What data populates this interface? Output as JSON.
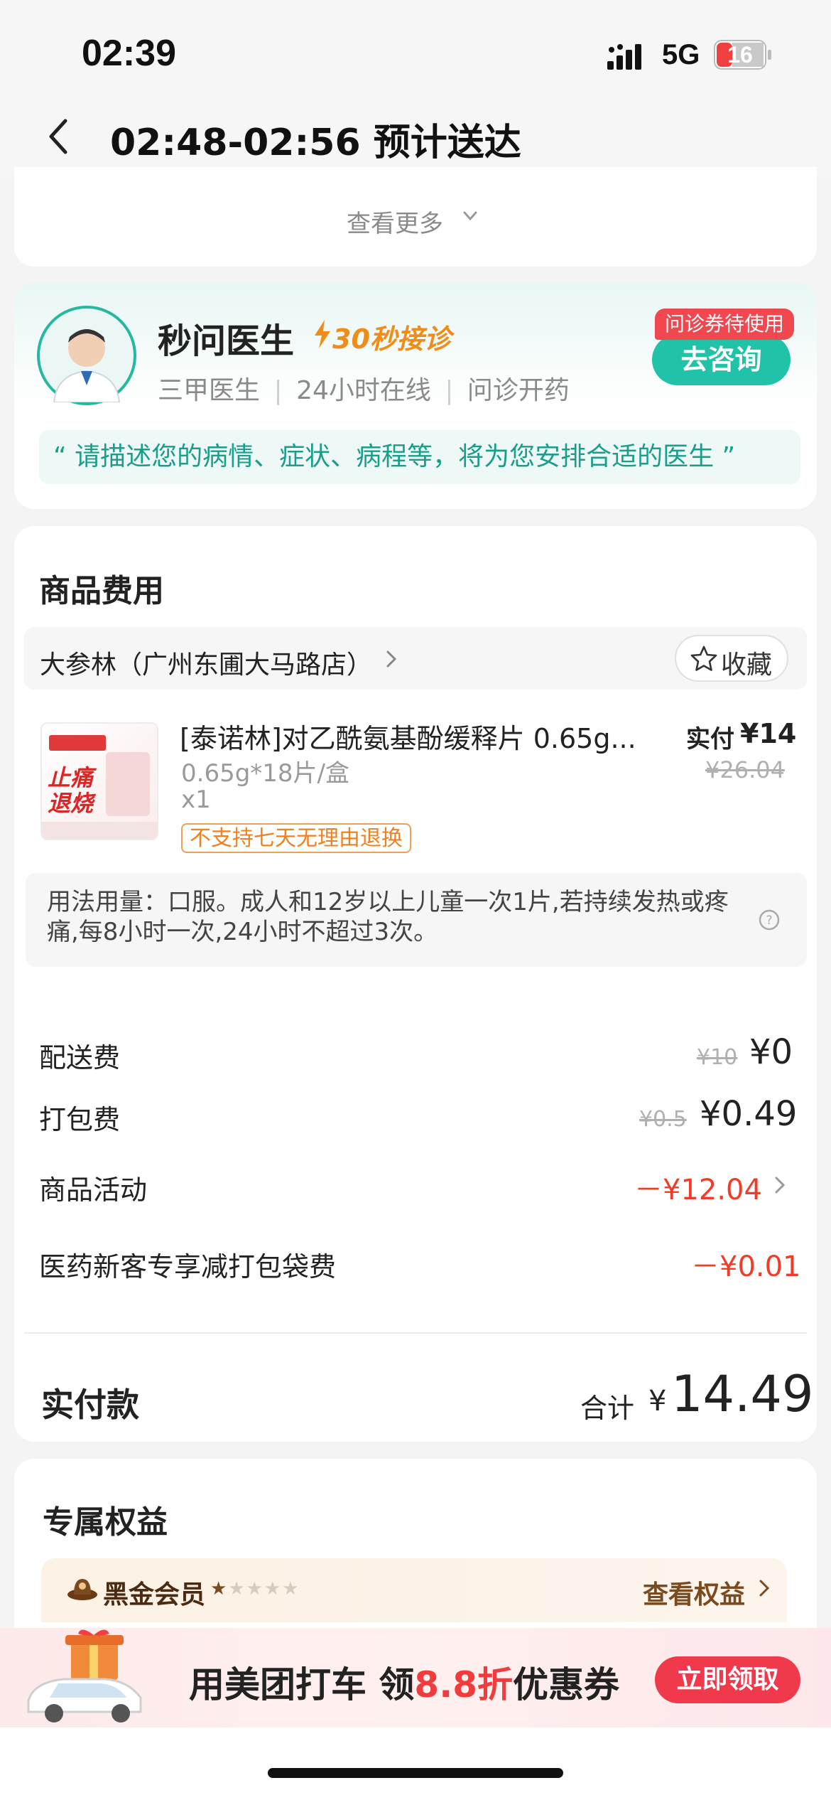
{
  "status": {
    "time": "02:39",
    "network": "5G",
    "battery": "16"
  },
  "header": {
    "title": "02:48-02:56 预计送达"
  },
  "more": {
    "label": "查看更多"
  },
  "doctor": {
    "name": "秒问医生",
    "tag": "30秒接诊",
    "attrs": [
      "三甲医生",
      "24小时在线",
      "问诊开药"
    ],
    "voucher": "问诊券待使用",
    "consult_button": "去咨询",
    "quote": "“ 请描述您的病情、症状、病程等，将为您安排合适的医生 ”"
  },
  "goods": {
    "section_title": "商品费用",
    "store": {
      "name": "大参林（广州东圃大马路店）",
      "favorite_label": "收藏"
    },
    "product": {
      "name": "[泰诺林]对乙酰氨基酚缓释片 0.65g...",
      "paid_label": "实付",
      "price": "¥14",
      "original_price": "¥26.04",
      "spec": "0.65g*18片/盒",
      "qty": "x1",
      "return_tag": "不支持七天无理由退换",
      "image_text": "止痛退烧"
    },
    "usage": "用法用量：口服。成人和12岁以上儿童一次1片,若持续发热或疼痛,每8小时一次,24小时不超过3次。"
  },
  "fees": {
    "delivery": {
      "label": "配送费",
      "original": "¥10",
      "value": "¥0"
    },
    "packing": {
      "label": "打包费",
      "original": "¥0.5",
      "value": "¥0.49"
    },
    "activity": {
      "label": "商品活动",
      "value": "－¥12.04"
    },
    "newcomer": {
      "label": "医药新客专享减打包袋费",
      "value": "－¥0.01"
    }
  },
  "payment": {
    "label": "实付款",
    "total_label": "合计",
    "currency": "¥",
    "total": "14.49"
  },
  "benefits": {
    "title": "专属权益",
    "member": {
      "name": "黑金会员",
      "stars_filled": 1,
      "stars_total": 5,
      "link": "查看权益"
    }
  },
  "banner": {
    "text_a": "用美团打车 领",
    "text_highlight": "8.8折",
    "text_b": "优惠券",
    "button": "立即领取"
  },
  "colors": {
    "accent_teal": "#20c3a8",
    "accent_red": "#f03c28",
    "tag_orange": "#f08d1a",
    "member_brown": "#7a4a20"
  }
}
